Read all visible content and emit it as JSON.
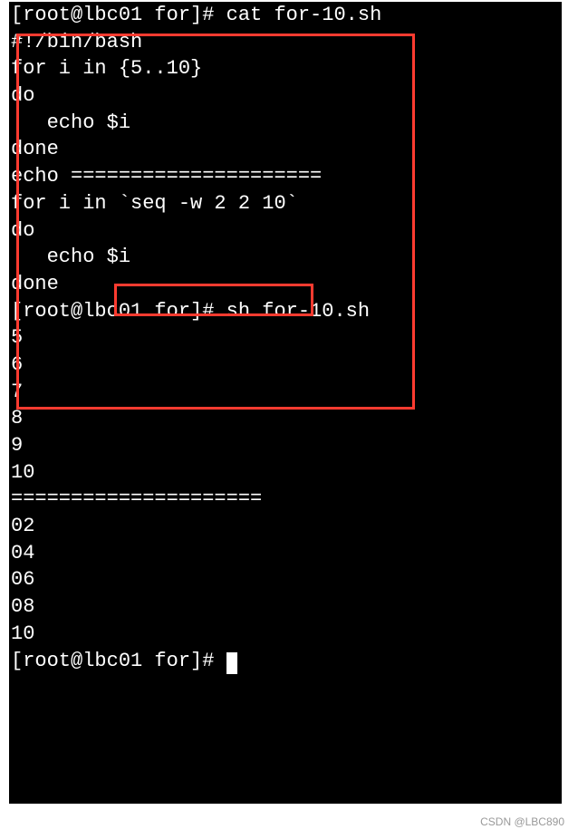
{
  "prompt1": "[root@lbc01 for]# cat for-10.sh",
  "script": {
    "l1": "#!/bin/bash",
    "l2": "for i in {5..10}",
    "l3": "do",
    "l4": "   echo $i",
    "l5": "done",
    "l6": "",
    "l7": "echo =====================",
    "l8": "",
    "l9": "for i in `seq -w 2 2 10`",
    "l10": "do",
    "l11": "   echo $i",
    "l12": "done"
  },
  "prompt2": "[root@lbc01 for]# sh for-10.sh",
  "output": {
    "o1": "5",
    "o2": "6",
    "o3": "7",
    "o4": "8",
    "o5": "9",
    "o6": "10",
    "o7": "=====================",
    "o8": "02",
    "o9": "04",
    "o10": "06",
    "o11": "08",
    "o12": "10"
  },
  "prompt3": "[root@lbc01 for]# ",
  "watermark": "CSDN @LBC890"
}
